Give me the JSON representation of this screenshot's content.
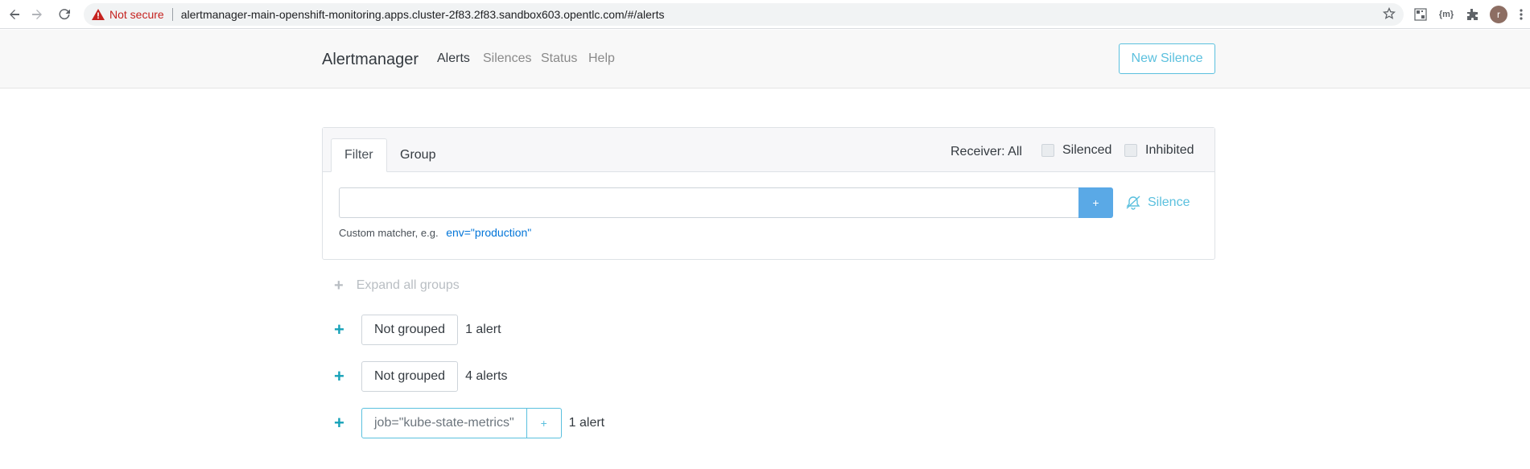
{
  "browser": {
    "not_secure": "Not secure",
    "url": "alertmanager-main-openshift-monitoring.apps.cluster-2f83.2f83.sandbox603.opentlc.com/#/alerts",
    "ext_badge": "{m}",
    "profile_initial": "r"
  },
  "navbar": {
    "brand": "Alertmanager",
    "links": [
      {
        "label": "Alerts",
        "active": true
      },
      {
        "label": "Silences",
        "active": false
      },
      {
        "label": "Status",
        "active": false
      },
      {
        "label": "Help",
        "active": false
      }
    ],
    "new_silence": "New Silence"
  },
  "filter_card": {
    "tabs": [
      "Filter",
      "Group"
    ],
    "active_tab": "Filter",
    "receiver": "Receiver: All",
    "silenced_label": "Silenced",
    "inhibited_label": "Inhibited",
    "input_value": "",
    "add_label": "+",
    "silence_label": "Silence",
    "hint_text": "Custom matcher, e.g.",
    "hint_example": "env=\"production\""
  },
  "groups": {
    "expand_all": "Expand all groups",
    "items": [
      {
        "label": "Not grouped",
        "count": "1 alert"
      },
      {
        "label": "Not grouped",
        "count": "4 alerts"
      },
      {
        "label": "job=\"kube-state-metrics\"",
        "add": "+",
        "count": "1 alert"
      }
    ]
  },
  "colors": {
    "accent": "#5bc0de",
    "primary": "#5aa9e6",
    "link": "#0275d8",
    "warning": "#c5221f"
  }
}
